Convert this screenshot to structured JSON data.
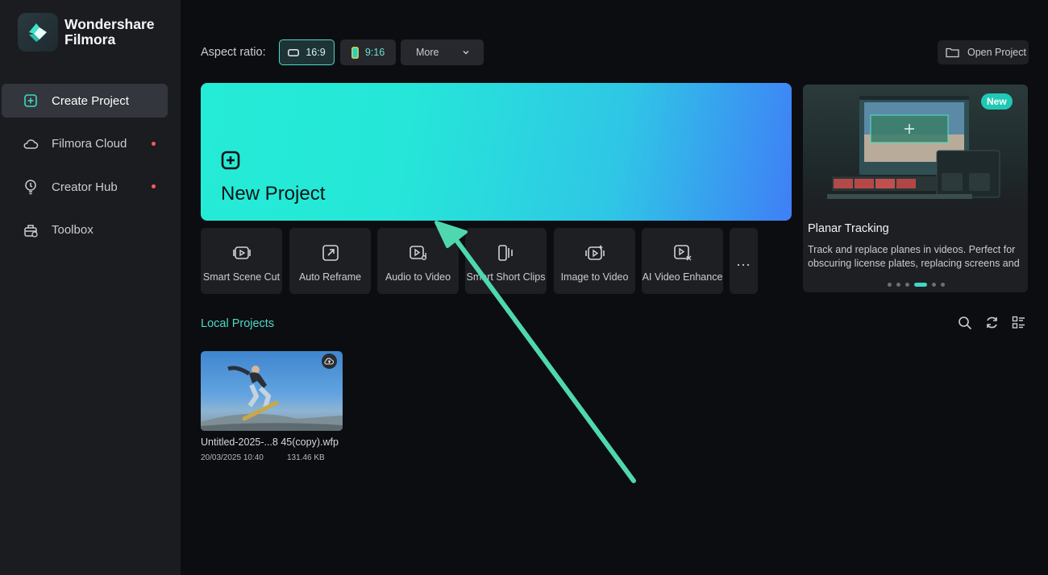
{
  "app": {
    "brand_line1": "Wondershare",
    "brand_line2": "Filmora"
  },
  "sidebar": {
    "items": [
      {
        "label": "Create Project",
        "icon": "plus-square-icon",
        "active": true,
        "dot": false
      },
      {
        "label": "Filmora Cloud",
        "icon": "cloud-icon",
        "active": false,
        "dot": true
      },
      {
        "label": "Creator Hub",
        "icon": "lightbulb-icon",
        "active": false,
        "dot": true
      },
      {
        "label": "Toolbox",
        "icon": "toolbox-icon",
        "active": false,
        "dot": false
      }
    ],
    "dot_color": "#ff5a5a"
  },
  "toolbar": {
    "aspect_label": "Aspect ratio:",
    "ratio_169": "16:9",
    "ratio_916": "9:16",
    "more_label": "More",
    "open_project_label": "Open Project"
  },
  "new_project": {
    "label": "New Project"
  },
  "tools": [
    {
      "label": "Smart Scene Cut",
      "icon": "smart-scene-cut-icon"
    },
    {
      "label": "Auto Reframe",
      "icon": "auto-reframe-icon"
    },
    {
      "label": "Audio to Video",
      "icon": "audio-to-video-icon"
    },
    {
      "label": "Smart Short Clips",
      "icon": "smart-short-clips-icon"
    },
    {
      "label": "Image to Video",
      "icon": "image-to-video-icon"
    },
    {
      "label": "AI Video Enhance",
      "icon": "ai-video-enhance-icon"
    }
  ],
  "tools_more": "...",
  "feature": {
    "badge": "New",
    "title": "Planar Tracking",
    "description": "Track and replace planes in videos. Perfect for obscuring license plates, replacing screens and",
    "dots_count": 6,
    "active_dot": 3
  },
  "local_projects": {
    "title": "Local Projects",
    "items": [
      {
        "name": "Untitled-2025-...8 45(copy).wfp",
        "date": "20/03/2025 10:40",
        "size": "131.46 KB"
      }
    ]
  },
  "colors": {
    "accent": "#4fd7c7",
    "background": "#0c0d10",
    "sidebar": "#1a1c20",
    "annotation_arrow": "#4fd7b0"
  }
}
